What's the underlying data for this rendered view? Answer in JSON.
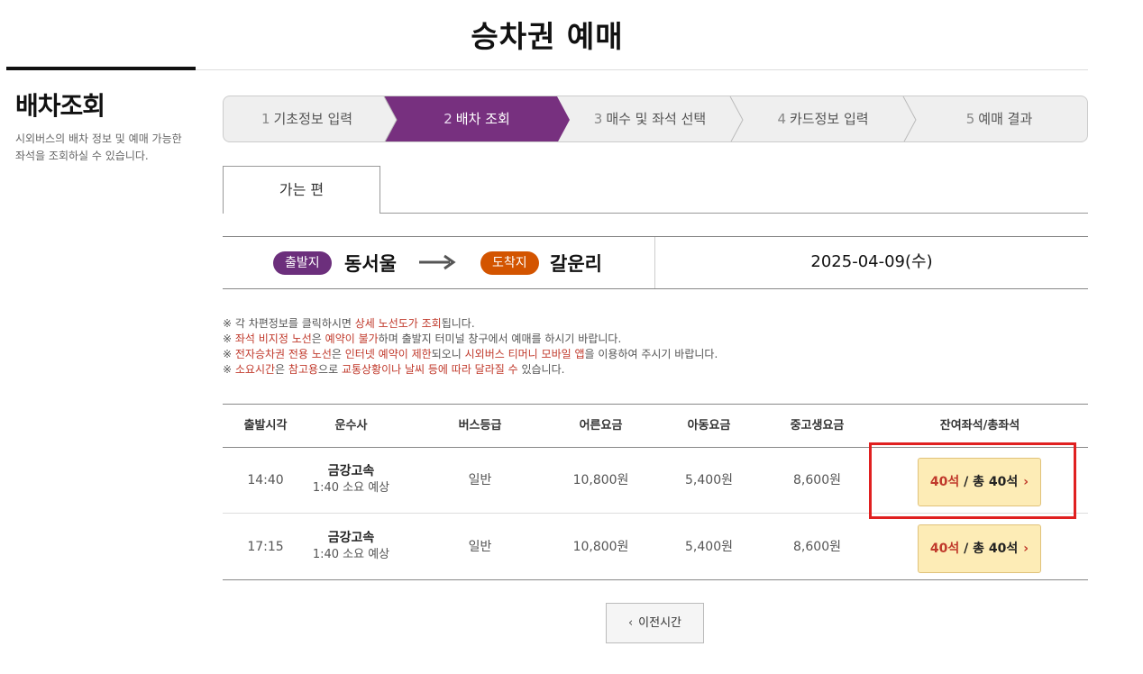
{
  "header": {
    "title": "승차권 예매"
  },
  "sidebar": {
    "title": "배차조회",
    "description": "시외버스의 배차 정보 및 예매 가능한 좌석을 조회하실 수 있습니다."
  },
  "steps": [
    {
      "num": "1",
      "label": "기초정보 입력"
    },
    {
      "num": "2",
      "label": "배차 조회"
    },
    {
      "num": "3",
      "label": "매수 및 좌석 선택"
    },
    {
      "num": "4",
      "label": "카드정보 입력"
    },
    {
      "num": "5",
      "label": "예매 결과"
    }
  ],
  "active_step": 2,
  "colors": {
    "active_step": "#77307f",
    "dep_badge": "#6c2f7c",
    "arr_badge": "#d35400",
    "seat_button": "#fdecb6",
    "highlight": "#e02020"
  },
  "tab": {
    "label": "가는 편"
  },
  "route": {
    "dep_badge": "출발지",
    "dep_place": "동서울",
    "arr_badge": "도착지",
    "arr_place": "갈운리",
    "date": "2025-04-09(수)"
  },
  "notices": {
    "n1_a": "※ 각 차편정보를 클릭하시면 ",
    "n1_red": "상세 노선도가 조회",
    "n1_b": "됩니다.",
    "n2_a": "※ ",
    "n2_red1": "좌석 비지정 노선",
    "n2_b": "은 ",
    "n2_red2": "예약이 불가",
    "n2_c": "하며 출발지 터미널 창구에서 예매를 하시기 바랍니다.",
    "n3_a": "※ ",
    "n3_red1": "전자승차권 전용 노선",
    "n3_b": "은 ",
    "n3_red2": "인터넷 예약이 제한",
    "n3_c": "되오니 ",
    "n3_red3": "시외버스 티머니 모바일 앱",
    "n3_d": "을 이용하여 주시기 바랍니다.",
    "n4_a": "※ ",
    "n4_red1": "소요시간",
    "n4_b": "은 ",
    "n4_red2": "참고용",
    "n4_c": "으로 ",
    "n4_red3": "교통상황이나 날씨 등에 따라 달라질 수",
    "n4_d": " 있습니다."
  },
  "table": {
    "headers": [
      "출발시각",
      "운수사",
      "버스등급",
      "어른요금",
      "아동요금",
      "중고생요금",
      "잔여좌석/총좌석"
    ],
    "rows": [
      {
        "time": "14:40",
        "company": "금강고속",
        "duration": "1:40 소요 예상",
        "grade": "일반",
        "adult": "10,800원",
        "child": "5,400원",
        "teen": "8,600원",
        "remain": "40석",
        "total": " / 총 40석"
      },
      {
        "time": "17:15",
        "company": "금강고속",
        "duration": "1:40 소요 예상",
        "grade": "일반",
        "adult": "10,800원",
        "child": "5,400원",
        "teen": "8,600원",
        "remain": "40석",
        "total": " / 총 40석"
      }
    ]
  },
  "prev_button": {
    "label": "이전시간"
  }
}
